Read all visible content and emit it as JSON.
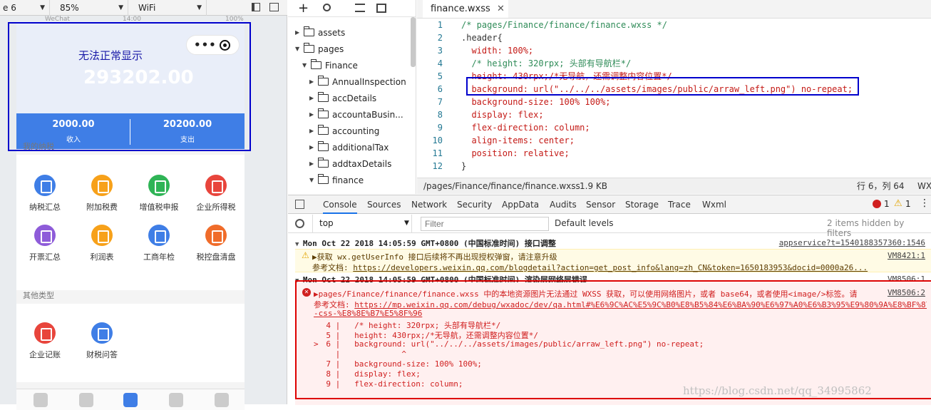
{
  "simulator": {
    "device": "e 6",
    "zoom": "85%",
    "network": "WiFi",
    "status_left": "WeChat",
    "status_mid": "14:00",
    "status_right": "100%"
  },
  "phone": {
    "header_title": "无法正常显示",
    "big_amount": "293202.00",
    "income_value": "2000.00",
    "income_label": "收入",
    "expense_value": "20200.00",
    "expense_label": "支出",
    "section1_title": "我的纳税",
    "section1_items": [
      {
        "label": "纳税汇总",
        "color": "#3f7ee6"
      },
      {
        "label": "附加税费",
        "color": "#f7a11a"
      },
      {
        "label": "增值税申报",
        "color": "#2fb456"
      },
      {
        "label": "企业所得税",
        "color": "#e8453c"
      },
      {
        "label": "开票汇总",
        "color": "#8e5cd9"
      },
      {
        "label": "利润表",
        "color": "#f7a11a"
      },
      {
        "label": "工商年检",
        "color": "#3f7ee6"
      },
      {
        "label": "税控盘清盘",
        "color": "#f06c2a"
      }
    ],
    "section2_title": "其他类型",
    "section2_items": [
      {
        "label": "企业记账",
        "color": "#e8453c"
      },
      {
        "label": "财税问答",
        "color": "#3f7ee6"
      }
    ]
  },
  "file_tree": {
    "items": [
      {
        "label": "assets",
        "expanded": false
      },
      {
        "label": "pages",
        "expanded": true
      },
      {
        "label": "Finance",
        "expanded": true
      },
      {
        "label": "AnnualInspection",
        "expanded": false
      },
      {
        "label": "accDetails",
        "expanded": false
      },
      {
        "label": "accountaBusin...",
        "expanded": false
      },
      {
        "label": "accounting",
        "expanded": false
      },
      {
        "label": "additionalTax",
        "expanded": false
      },
      {
        "label": "addtaxDetails",
        "expanded": false
      },
      {
        "label": "finance",
        "expanded": true
      }
    ]
  },
  "editor": {
    "tab_label": "finance.wxss",
    "lines": [
      {
        "n": "1",
        "text": "/* pages/Finance/finance/finance.wxss */"
      },
      {
        "n": "2",
        "text": ".header{"
      },
      {
        "n": "3",
        "text": "  width: 100%;"
      },
      {
        "n": "4",
        "text": "  /* height: 320rpx; 头部有导航栏*/"
      },
      {
        "n": "5",
        "text": "  height: 430rpx;/*无导航，还需调整内容位置*/"
      },
      {
        "n": "6",
        "text": "  background: url(\"../../../assets/images/public/arraw_left.png\") no-repeat;"
      },
      {
        "n": "7",
        "text": "  background-size: 100% 100%;"
      },
      {
        "n": "8",
        "text": "  display: flex;"
      },
      {
        "n": "9",
        "text": "  flex-direction: column;"
      },
      {
        "n": "10",
        "text": "  align-items: center;"
      },
      {
        "n": "11",
        "text": "  position: relative;"
      },
      {
        "n": "12",
        "text": "}"
      }
    ],
    "status_path": "/pages/Finance/finance/finance.wxss",
    "status_size": "1.9 KB",
    "status_pos": "行 6，列 64",
    "status_extra": "WX"
  },
  "console": {
    "tabs": [
      "Console",
      "Sources",
      "Network",
      "Security",
      "AppData",
      "Audits",
      "Sensor",
      "Storage",
      "Trace",
      "Wxml"
    ],
    "error_count": "1",
    "warn_count": "1",
    "context": "top",
    "filter_placeholder": "Filter",
    "levels": "Default levels",
    "hidden": "2 items hidden by filters",
    "msg1_date": "Mon Oct 22 2018 14:05:59 GMT+0800 (中国标准时间) 接口调整",
    "msg1_src": "appservice?t=1540188357360:1546",
    "warn_text": "▶获取 wx.getUserInfo 接口后续将不再出现授权弹窗，请注意升级",
    "warn_src": "VM8421:1",
    "warn_doc_label": "参考文档:",
    "warn_doc_link": "https://developers.weixin.qq.com/blogdetail?action=get_post_info&lang=zh_CN&token=1650183953&docid=0000a26...",
    "msg2_date": "Mon Oct 22 2018 14:05:59 GMT+0800 (中国标准时间) 渲染层网络层错误",
    "msg2_src": "VM8506:1",
    "err_text": "▶pages/Finance/finance/finance.wxss 中的本地资源图片无法通过 WXSS 获取，可以使用网络图片，或者 base64，或者使用<image/>标签。请",
    "err_src": "VM8506:2",
    "err_doc_label": "参考文档:",
    "err_doc_link": "https://mp.weixin.qq.com/debug/wxadoc/dev/qa.html#%E6%9C%AC%E5%9C%B0%E8%B5%84%E6%BA%90%E6%97%A0%E6%B3%95%E9%80%9A%E8%BF%87",
    "err_doc_link2": "-css-%E8%8E%B7%E5%8F%96",
    "snippet": [
      {
        "mark": "",
        "n": "4",
        "text": "/* height: 320rpx; 头部有导航栏*/"
      },
      {
        "mark": "",
        "n": "5",
        "text": "height: 430rpx;/*无导航，还需调整内容位置*/"
      },
      {
        "mark": ">",
        "n": "6",
        "text": "background: url(\"../../../assets/images/public/arraw_left.png\") no-repeat;"
      },
      {
        "mark": "",
        "n": "",
        "text": "          ^"
      },
      {
        "mark": "",
        "n": "7",
        "text": "background-size: 100% 100%;"
      },
      {
        "mark": "",
        "n": "8",
        "text": "display: flex;"
      },
      {
        "mark": "",
        "n": "9",
        "text": "flex-direction: column;"
      }
    ],
    "watermark": "https://blog.csdn.net/qq_34995862"
  },
  "colors": {
    "accent": "#3f7ee6",
    "highlight_blue": "#0000cc",
    "highlight_red": "#dd0000",
    "error_red": "#d01f1f"
  }
}
